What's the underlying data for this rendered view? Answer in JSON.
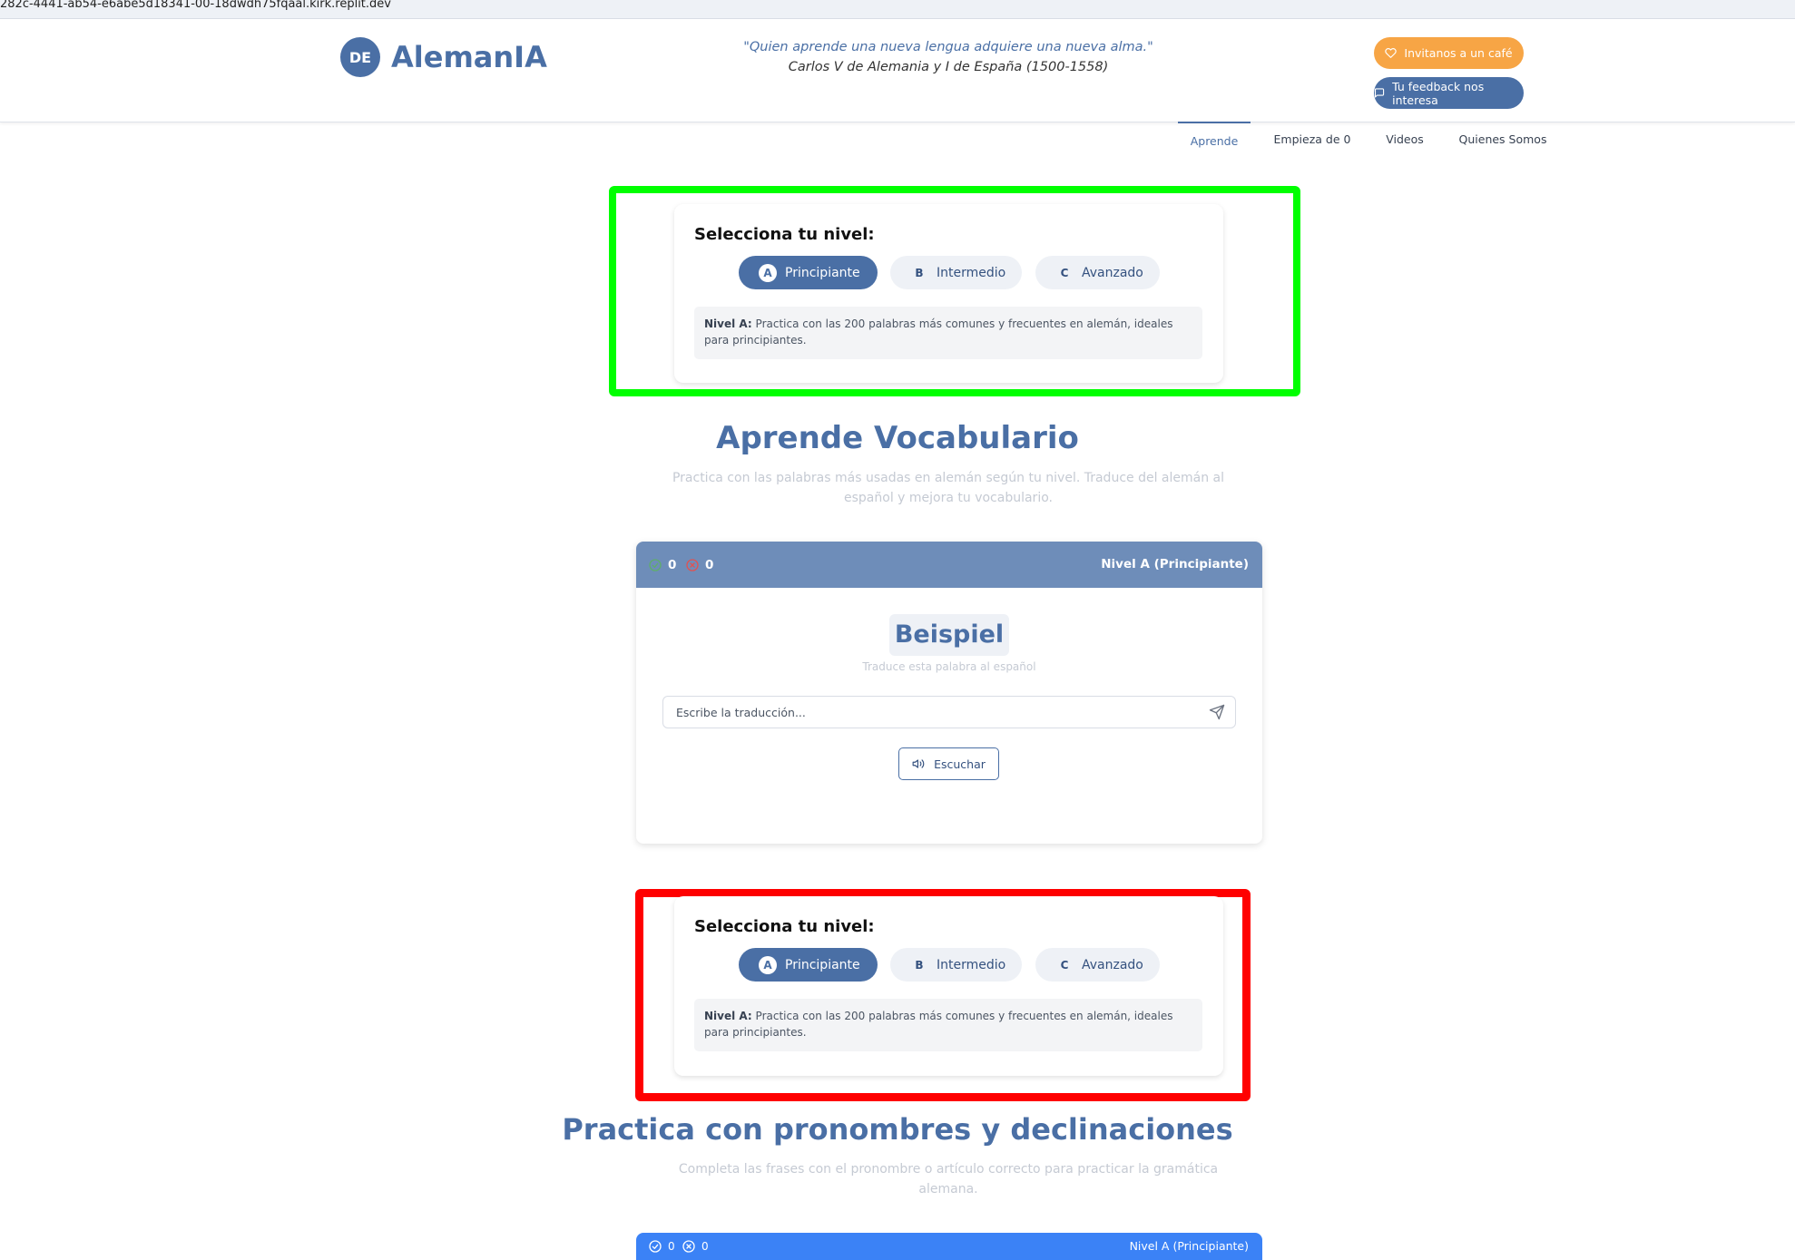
{
  "browser": {
    "url": "282c-4441-ab54-e6abe5d18341-00-18dwdh75fqaal.kirk.replit.dev"
  },
  "header": {
    "logo_badge": "DE",
    "logo_text": "AlemanIA",
    "quote": "\"Quien aprende una nueva lengua adquiere una nueva alma.\"",
    "quote_author": "Carlos V de Alemania y I de España (1500-1558)",
    "cafe_button": "Invitanos a un café",
    "feedback_button": "Tu feedback nos interesa"
  },
  "nav": {
    "items": [
      {
        "label": "Aprende",
        "active": true
      },
      {
        "label": "Empieza de 0",
        "active": false
      },
      {
        "label": "Videos",
        "active": false
      },
      {
        "label": "Quienes Somos",
        "active": false
      }
    ]
  },
  "level_selector_1": {
    "title": "Selecciona tu nivel:",
    "levels": [
      {
        "letter": "A",
        "label": "Principiante",
        "selected": true
      },
      {
        "letter": "B",
        "label": "Intermedio",
        "selected": false
      },
      {
        "letter": "C",
        "label": "Avanzado",
        "selected": false
      }
    ],
    "description_prefix": "Nivel A:",
    "description": "Practica con las 200 palabras más comunes y frecuentes en alemán, ideales para principiantes."
  },
  "vocabulary": {
    "title": "Aprende Vocabulario",
    "subtitle": "Practica con las palabras más usadas en alemán según tu nivel. Traduce del alemán al español y mejora tu vocabulario.",
    "correct_count": "0",
    "wrong_count": "0",
    "level_label": "Nivel A (Principiante)",
    "word": "Beispiel",
    "hint": "Traduce esta palabra al español",
    "input_placeholder": "Escribe la traducción...",
    "listen_button": "Escuchar"
  },
  "level_selector_2": {
    "title": "Selecciona tu nivel:",
    "levels": [
      {
        "letter": "A",
        "label": "Principiante",
        "selected": true
      },
      {
        "letter": "B",
        "label": "Intermedio",
        "selected": false
      },
      {
        "letter": "C",
        "label": "Avanzado",
        "selected": false
      }
    ],
    "description_prefix": "Nivel A:",
    "description": "Practica con las 200 palabras más comunes y frecuentes en alemán, ideales para principiantes."
  },
  "pronouns": {
    "title": "Practica con pronombres y declinaciones",
    "subtitle": "Completa las frases con el pronombre o artículo correcto para practicar la gramática alemana.",
    "correct_count": "0",
    "wrong_count": "0",
    "level_label": "Nivel A (Principiante)"
  },
  "colors": {
    "primary": "#4a6fa5",
    "accent_orange": "#f7a545",
    "quiz_header": "#6e8db9",
    "quiz2_header": "#3b82f6",
    "highlight_green": "#00ff00",
    "highlight_red": "#ff0000"
  },
  "icons": {
    "cafe": "heart-icon",
    "feedback": "message-icon",
    "correct": "check-circle-icon",
    "wrong": "x-circle-icon",
    "send": "send-icon",
    "listen": "speaker-icon"
  }
}
